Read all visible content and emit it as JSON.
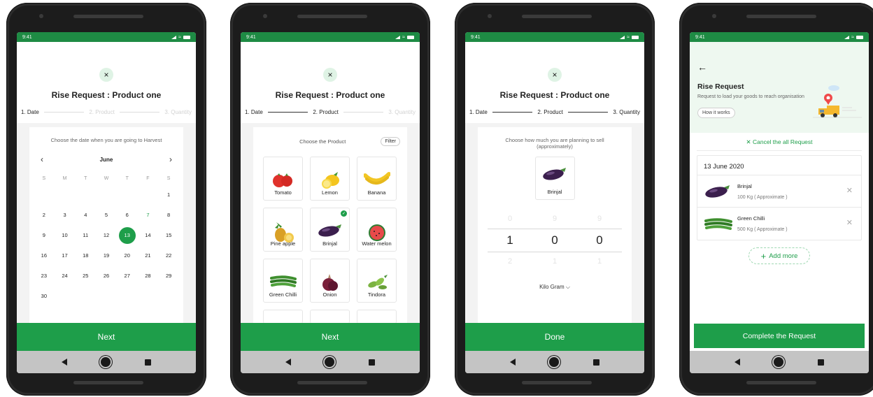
{
  "status_time": "9:41",
  "colors": {
    "brand_green": "#1e9e4a",
    "status_green": "#1e8b44",
    "light_green": "#dff3e5"
  },
  "request_title": "Rise Request : Product one",
  "steps": [
    "1. Date",
    "2. Product",
    "3. Quantity"
  ],
  "next_label": "Next",
  "close_icon": "×",
  "calendar": {
    "hint": "Choose the date when you are going to Harvest",
    "month": "June",
    "prev_icon": "‹",
    "next_icon": "›",
    "weekdays": [
      "S",
      "M",
      "T",
      "W",
      "T",
      "F",
      "S"
    ],
    "rows": [
      [
        "",
        "",
        "",
        "",
        "",
        "",
        "1"
      ],
      [
        "2",
        "3",
        "4",
        "5",
        "6",
        "7",
        "8"
      ],
      [
        "9",
        "10",
        "11",
        "12",
        "13",
        "14",
        "15"
      ],
      [
        "16",
        "17",
        "18",
        "19",
        "20",
        "21",
        "22"
      ],
      [
        "23",
        "24",
        "25",
        "26",
        "27",
        "28",
        "29"
      ],
      [
        "30",
        "",
        "",
        "",
        "",
        "",
        ""
      ]
    ],
    "selected_day": "13",
    "highlight_day": "7"
  },
  "products": {
    "hint": "Choose the Product",
    "filter_label": "Filter",
    "items": [
      {
        "name": "Tomato",
        "icon": "tomato-icon"
      },
      {
        "name": "Lemon",
        "icon": "lemon-icon"
      },
      {
        "name": "Banana",
        "icon": "banana-icon"
      },
      {
        "name": "Pine apple",
        "icon": "pineapple-icon"
      },
      {
        "name": "Brinjal",
        "icon": "brinjal-icon",
        "selected": true
      },
      {
        "name": "Water melon",
        "icon": "watermelon-icon"
      },
      {
        "name": "Green Chilli",
        "icon": "green-chilli-icon"
      },
      {
        "name": "Onion",
        "icon": "onion-icon"
      },
      {
        "name": "Tindora",
        "icon": "tindora-icon"
      }
    ]
  },
  "quantity": {
    "hint": "Choose how much you are planning to sell (approximately)",
    "product": "Brinjal",
    "picker_above": [
      "0",
      "9",
      "9"
    ],
    "picker_selected": [
      "1",
      "0",
      "0"
    ],
    "picker_below": [
      "2",
      "1",
      "1"
    ],
    "unit": "Kilo Gram",
    "done_label": "Done"
  },
  "summary": {
    "back_icon": "←",
    "title": "Rise Request",
    "subtitle": "Request to load your goods to reach organisation",
    "how_label": "How it works",
    "cancel_all": "Cancel the all Request",
    "date": "13 June 2020",
    "items": [
      {
        "name": "Brinjal",
        "qty": "100 Kg ( Approximate )"
      },
      {
        "name": "Green Chilli",
        "qty": "500 Kg ( Approximate )"
      }
    ],
    "add_more": "Add more",
    "complete_label": "Complete the Request"
  }
}
